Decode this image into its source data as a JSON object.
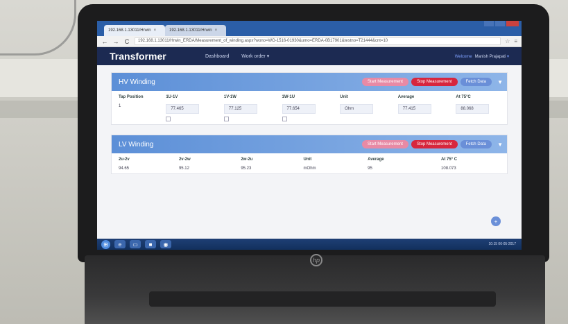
{
  "browser": {
    "tabs": [
      {
        "label": "192.168.1.13011/Hrwin",
        "close": "×"
      },
      {
        "label": "192.168.1.13011/Hrwin",
        "close": "×"
      }
    ],
    "url": "192.168.1.13011/Hrwin_ERDA/Measurement_of_winding.aspx?wono=WO-1516-01930&umo=ERDA-0B17901&testno=T21444&cnt=10",
    "nav": {
      "back": "←",
      "forward": "→",
      "reload": "C"
    }
  },
  "app": {
    "brand": "Transformer",
    "nav": [
      "Dashboard",
      "Work order"
    ],
    "welcome_label": "Welcome",
    "user": "Manish Prajapati"
  },
  "hv": {
    "title": "HV Winding",
    "buttons": {
      "start": "Start Measurement",
      "stop": "Stop Measurement",
      "fetch": "Fetch Data"
    },
    "headers": [
      "Tap Position",
      "1U-1V",
      "1V-1W",
      "1W-1U",
      "Unit",
      "Average",
      "At 75°C"
    ],
    "row": {
      "tap": "1",
      "u1v1": "77.465",
      "v1w1": "77.125",
      "w1u1": "77.654",
      "unit": "Ohm",
      "average": "77.415",
      "at75": "88.068"
    }
  },
  "lv": {
    "title": "LV Winding",
    "buttons": {
      "start": "Start Measurement",
      "stop": "Stop Measurement",
      "fetch": "Fetch Data"
    },
    "headers": [
      "2u-2v",
      "2v-2w",
      "2w-2u",
      "Unit",
      "Average",
      "At 75° C"
    ],
    "row": {
      "u2v2": "94.65",
      "v2w2": "95.12",
      "w2u2": "95.23",
      "unit": "mOhm",
      "average": "95",
      "at75": "108.073"
    }
  },
  "taskbar": {
    "clock": "10:15 06-05-2017"
  },
  "brand_logo": "hp"
}
